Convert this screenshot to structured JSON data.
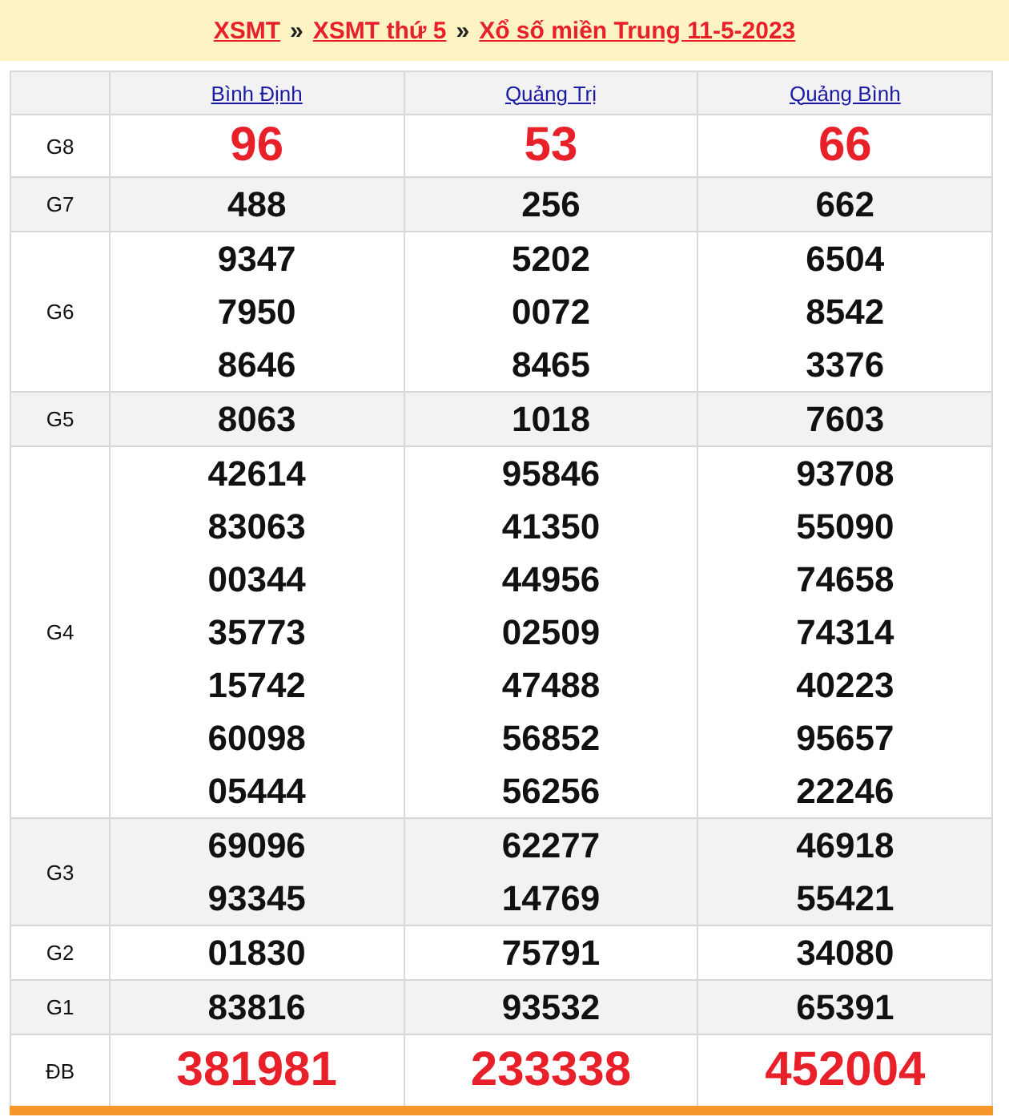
{
  "breadcrumb": [
    {
      "label": "XSMT"
    },
    {
      "label": "XSMT thứ 5"
    },
    {
      "label": "Xổ số miền Trung 11-5-2023"
    }
  ],
  "separator": "»",
  "provinces": [
    "Bình Định",
    "Quảng Trị",
    "Quảng Bình"
  ],
  "prizes": [
    {
      "label": "G8",
      "kind": "big",
      "shaded": false,
      "numbers": [
        [
          "96"
        ],
        [
          "53"
        ],
        [
          "66"
        ]
      ]
    },
    {
      "label": "G7",
      "kind": "normal",
      "shaded": true,
      "numbers": [
        [
          "488"
        ],
        [
          "256"
        ],
        [
          "662"
        ]
      ]
    },
    {
      "label": "G6",
      "kind": "normal",
      "shaded": false,
      "numbers": [
        [
          "9347",
          "7950",
          "8646"
        ],
        [
          "5202",
          "0072",
          "8465"
        ],
        [
          "6504",
          "8542",
          "3376"
        ]
      ]
    },
    {
      "label": "G5",
      "kind": "normal",
      "shaded": true,
      "numbers": [
        [
          "8063"
        ],
        [
          "1018"
        ],
        [
          "7603"
        ]
      ]
    },
    {
      "label": "G4",
      "kind": "normal",
      "shaded": false,
      "numbers": [
        [
          "42614",
          "83063",
          "00344",
          "35773",
          "15742",
          "60098",
          "05444"
        ],
        [
          "95846",
          "41350",
          "44956",
          "02509",
          "47488",
          "56852",
          "56256"
        ],
        [
          "93708",
          "55090",
          "74658",
          "74314",
          "40223",
          "95657",
          "22246"
        ]
      ]
    },
    {
      "label": "G3",
      "kind": "normal",
      "shaded": true,
      "numbers": [
        [
          "69096",
          "93345"
        ],
        [
          "62277",
          "14769"
        ],
        [
          "46918",
          "55421"
        ]
      ]
    },
    {
      "label": "G2",
      "kind": "normal",
      "shaded": false,
      "numbers": [
        [
          "01830"
        ],
        [
          "75791"
        ],
        [
          "34080"
        ]
      ]
    },
    {
      "label": "G1",
      "kind": "normal",
      "shaded": true,
      "numbers": [
        [
          "83816"
        ],
        [
          "93532"
        ],
        [
          "65391"
        ]
      ]
    },
    {
      "label": "ĐB",
      "kind": "big",
      "shaded": false,
      "numbers": [
        [
          "381981"
        ],
        [
          "233338"
        ],
        [
          "452004"
        ]
      ]
    }
  ]
}
